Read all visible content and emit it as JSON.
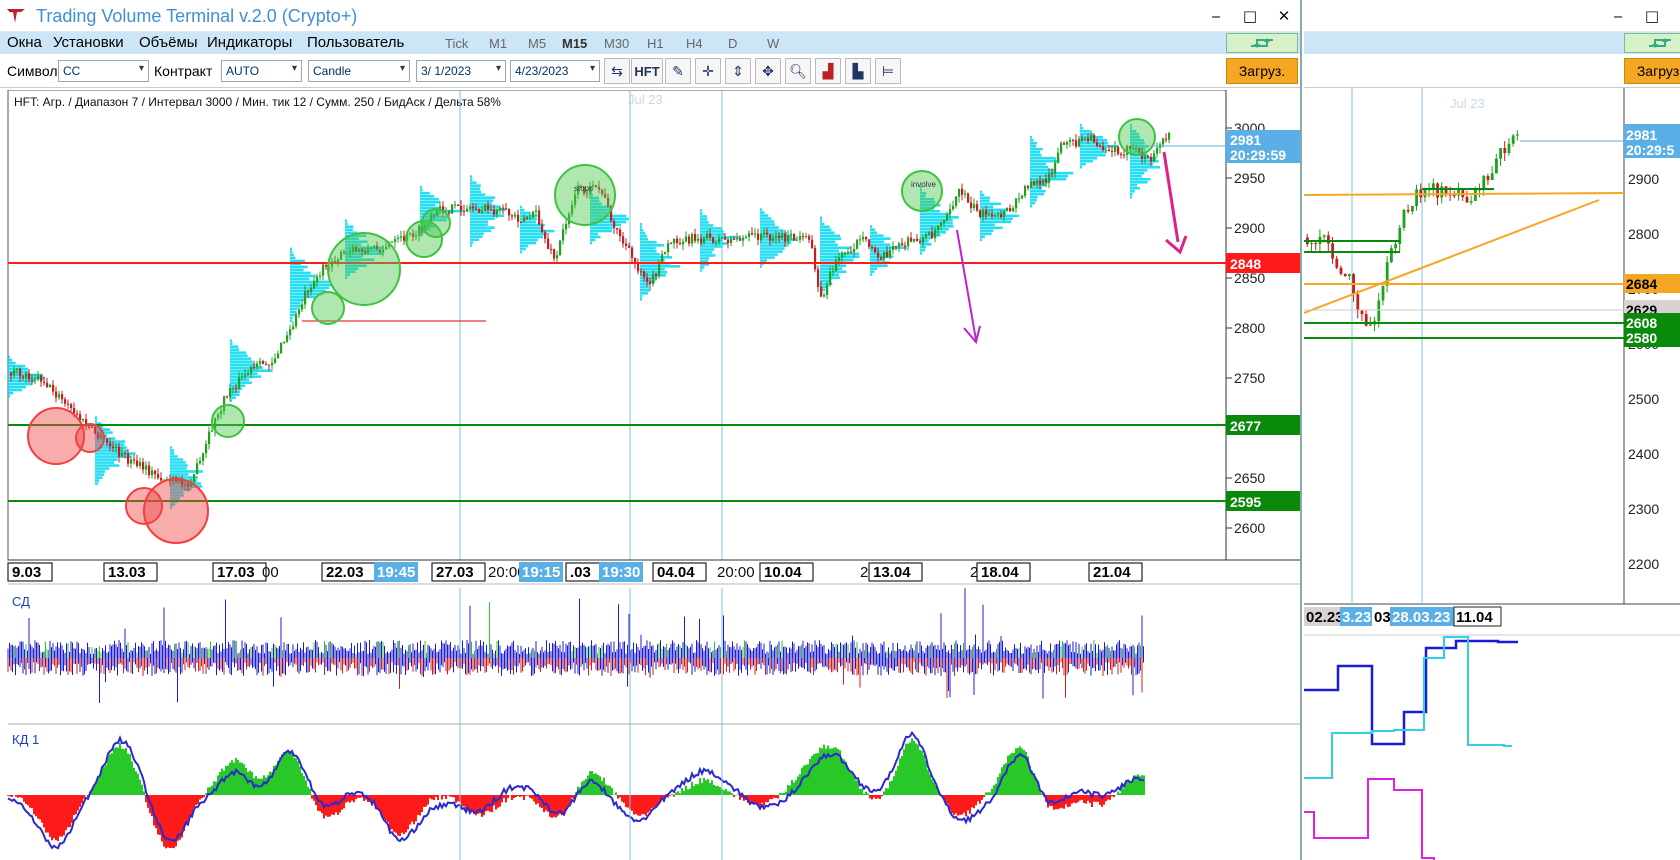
{
  "app": {
    "title": "Trading Volume Terminal v.2.0 (Crypto+)",
    "window_controls": {
      "minimize": "‒",
      "maximize": "□",
      "close": "✕"
    }
  },
  "menu": [
    "Окна",
    "Установки",
    "Объёмы",
    "Индикаторы",
    "Пользователь"
  ],
  "timeframes": {
    "items": [
      "Tick",
      "M1",
      "M5",
      "M15",
      "M30",
      "H1",
      "H4",
      "D",
      "W"
    ],
    "selected": "M15"
  },
  "toolbar": {
    "symbol_label": "Символ",
    "symbol_value": "CC",
    "contract_label": "Контракт",
    "contract_value": "AUTO",
    "chart_type": "Candle",
    "date_from": "3/ 1/2023",
    "date_to": "4/23/2023",
    "hft_label": "HFT",
    "load_label": "Загруз.",
    "tool_icons": [
      "arrows-swap-icon",
      "hft-button",
      "pencil-icon",
      "crosshair-icon",
      "fit-vertical-icon",
      "move-icon",
      "zoom-icon",
      "profile-chart-icon",
      "split-profile-icon",
      "range-icon"
    ]
  },
  "main_chart": {
    "info": "HFT: Агр. / Диапазон 7 / Интервал 3000 / Мин. тик 12 / Сумм. 250 / БидАск / Дельта 58%",
    "watermark": "Jul 23",
    "y_ticks": [
      "3000",
      "2950",
      "2900",
      "2850",
      "2800",
      "2750",
      "2700",
      "2650",
      "2600"
    ],
    "price_tag": {
      "price": "2981",
      "time": "20:29:59"
    },
    "levels": [
      {
        "value": "2848",
        "color": "#ff1a1a"
      },
      {
        "value": "2677",
        "color": "#0a8a0a"
      },
      {
        "value": "2595",
        "color": "#0a8a0a"
      }
    ],
    "circle_labels": [
      "stops",
      "involve"
    ],
    "x_labels": [
      "9.03",
      "13.03",
      "17.03",
      "22.03",
      "27.03",
      ".03",
      "04.04",
      "10.04",
      "13.04",
      "18.04",
      "21.04"
    ],
    "x_label_fragments": [
      "00",
      "20:00",
      "20:00",
      "2",
      "2"
    ],
    "x_time_tags": [
      "19:45",
      "19:15",
      "19:30"
    ],
    "colors": {
      "bull": "#1fa31f",
      "bear": "#c02020",
      "profile": "#00d8f0",
      "circle_green": "#3fc23f",
      "circle_red": "#f04040",
      "arrow": "#e0208a"
    }
  },
  "indicators": [
    {
      "name": "СД",
      "colors": [
        "#1c1cd0",
        "#d02020",
        "#28c828"
      ]
    },
    {
      "name": "КД 1",
      "colors": [
        "#28c828",
        "#ff1a1a",
        "#2a2ad0"
      ]
    }
  ],
  "right_chart": {
    "watermark": "Jul 23",
    "y_ticks": [
      "2900",
      "2800",
      "2700",
      "2600",
      "2500",
      "2400",
      "2300",
      "2200"
    ],
    "price_tag": {
      "price": "2981",
      "time": "20:29:5"
    },
    "level_tags": [
      {
        "value": "2684",
        "color": "#f5a623"
      },
      {
        "value": "2629",
        "color": "#d8d2d2"
      },
      {
        "value": "2608",
        "color": "#0a8a0a"
      },
      {
        "value": "2580",
        "color": "#0a8a0a"
      }
    ],
    "x_labels": [
      "02.23",
      "3.23",
      "03",
      "28.03.23",
      "11.04"
    ],
    "load_label": "Загруз."
  }
}
